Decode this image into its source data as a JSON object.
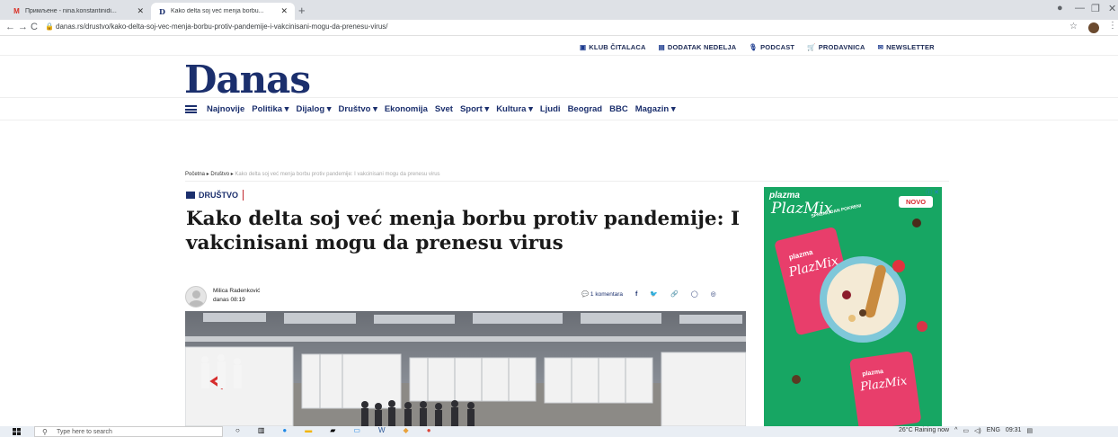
{
  "browser": {
    "tabs": [
      {
        "title": "Примљене - nina.konstantinidi...",
        "favicon": "M",
        "close": "✕",
        "active": false
      },
      {
        "title": "Kako delta soj već menja borbu...",
        "favicon": "D",
        "close": "✕",
        "active": true
      }
    ],
    "new_tab": "+",
    "url": "danas.rs/drustvo/kako-delta-soj-vec-menja-borbu-protiv-pandemije-i-vakcinisani-mogu-da-prenesu-virus/"
  },
  "topnav": {
    "items": [
      {
        "icon": "newspaper-icon",
        "label": "KLUB ČITALACA"
      },
      {
        "icon": "bars-icon",
        "label": "DODATAK NEDELJA"
      },
      {
        "icon": "microphone-icon",
        "label": "PODCAST"
      },
      {
        "icon": "cart-icon",
        "label": "PRODAVNICA"
      },
      {
        "icon": "envelope-icon",
        "label": "NEWSLETTER"
      }
    ]
  },
  "logo": "Danas",
  "mainnav": {
    "items": [
      "Najnovije",
      "Politika ▾",
      "Dijalog ▾",
      "Društvo ▾",
      "Ekonomija",
      "Svet",
      "Sport ▾",
      "Kultura ▾",
      "Ljudi",
      "Beograd",
      "BBC",
      "Magazin ▾"
    ]
  },
  "breadcrumb": {
    "home": "Početna",
    "section": "Društvo",
    "current": "Kako delta soj već menja borbu protiv pandemije: I vakcinisani mogu da prenesu virus"
  },
  "article": {
    "category": "DRUŠTVO",
    "headline": "Kako delta soj već menja borbu protiv pandemije: I vakcinisani mogu da prenesu virus",
    "author": "Milica Radenković",
    "date": "danas 08:19",
    "comments": "1 komentara"
  },
  "ad": {
    "brand": "plazma",
    "product": "PlazMix",
    "tagline": "SPREMI, DAN POKRENI",
    "badge": "NOVO",
    "close": "ⓘ ✕"
  },
  "taskbar": {
    "search_placeholder": "Type here to search",
    "weather": "26°C Raining now",
    "lang": "ENG",
    "time": "09:31"
  },
  "colors": {
    "brand": "#1b2f6d",
    "ad_green": "#17a663",
    "accent_red": "#c1272d"
  }
}
